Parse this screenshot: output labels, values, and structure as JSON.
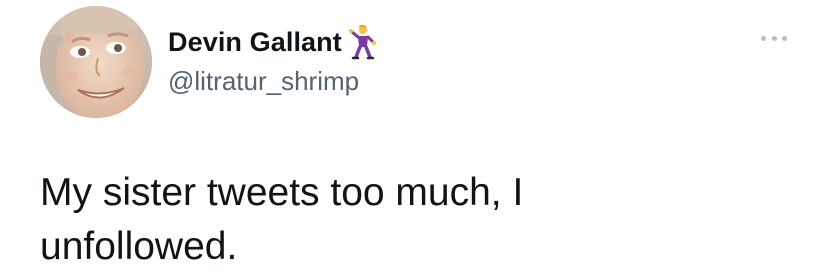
{
  "tweet": {
    "author": {
      "display_name": "Devin Gallant",
      "handle": "@litratur_shrimp",
      "name_emoji": "dancing-man-emoji"
    },
    "text_line1": "My sister tweets too much, I",
    "text_line2": "unfollowed.",
    "more_icon": "more-options-icon"
  },
  "colors": {
    "text_primary": "#0f1419",
    "text_secondary": "#536471",
    "more_dots": "#b6bec4",
    "background": "#ffffff"
  }
}
